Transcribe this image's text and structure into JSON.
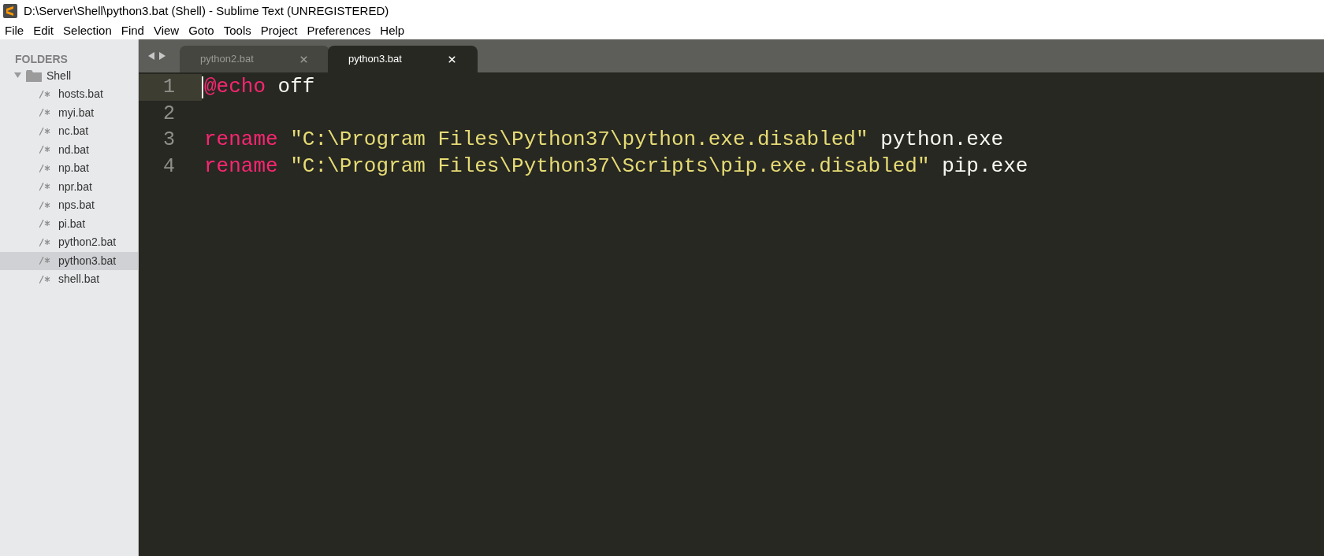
{
  "window": {
    "title": "D:\\Server\\Shell\\python3.bat (Shell) - Sublime Text (UNREGISTERED)"
  },
  "menu": [
    "File",
    "Edit",
    "Selection",
    "Find",
    "View",
    "Goto",
    "Tools",
    "Project",
    "Preferences",
    "Help"
  ],
  "sidebar": {
    "heading": "FOLDERS",
    "folder": {
      "name": "Shell",
      "expanded": true,
      "children": [
        {
          "name": "hosts.bat",
          "selected": false
        },
        {
          "name": "myi.bat",
          "selected": false
        },
        {
          "name": "nc.bat",
          "selected": false
        },
        {
          "name": "nd.bat",
          "selected": false
        },
        {
          "name": "np.bat",
          "selected": false
        },
        {
          "name": "npr.bat",
          "selected": false
        },
        {
          "name": "nps.bat",
          "selected": false
        },
        {
          "name": "pi.bat",
          "selected": false
        },
        {
          "name": "python2.bat",
          "selected": false
        },
        {
          "name": "python3.bat",
          "selected": true
        },
        {
          "name": "shell.bat",
          "selected": false
        }
      ]
    }
  },
  "tabs": [
    {
      "label": "python2.bat",
      "selected": false
    },
    {
      "label": "python3.bat",
      "selected": true
    }
  ],
  "editor": {
    "lines": [
      {
        "number": "1",
        "current": true,
        "tokens": [
          {
            "kind": "keyword",
            "text": "@echo"
          },
          {
            "kind": "plain",
            "text": " off"
          }
        ]
      },
      {
        "number": "2",
        "current": false
      },
      {
        "number": "3",
        "current": false,
        "tokens": [
          {
            "kind": "keyword",
            "text": "rename"
          },
          {
            "kind": "string",
            "text": " \"C:\\Program Files\\Python37\\python.exe.disabled\""
          },
          {
            "kind": "plain",
            "text": " python.exe"
          }
        ]
      },
      {
        "number": "4",
        "current": false,
        "tokens": [
          {
            "kind": "keyword",
            "text": "rename"
          },
          {
            "kind": "string",
            "text": " \"C:\\Program Files\\Python37\\Scripts\\pip.exe.disabled\""
          },
          {
            "kind": "plain",
            "text": " pip.exe"
          }
        ]
      }
    ]
  }
}
